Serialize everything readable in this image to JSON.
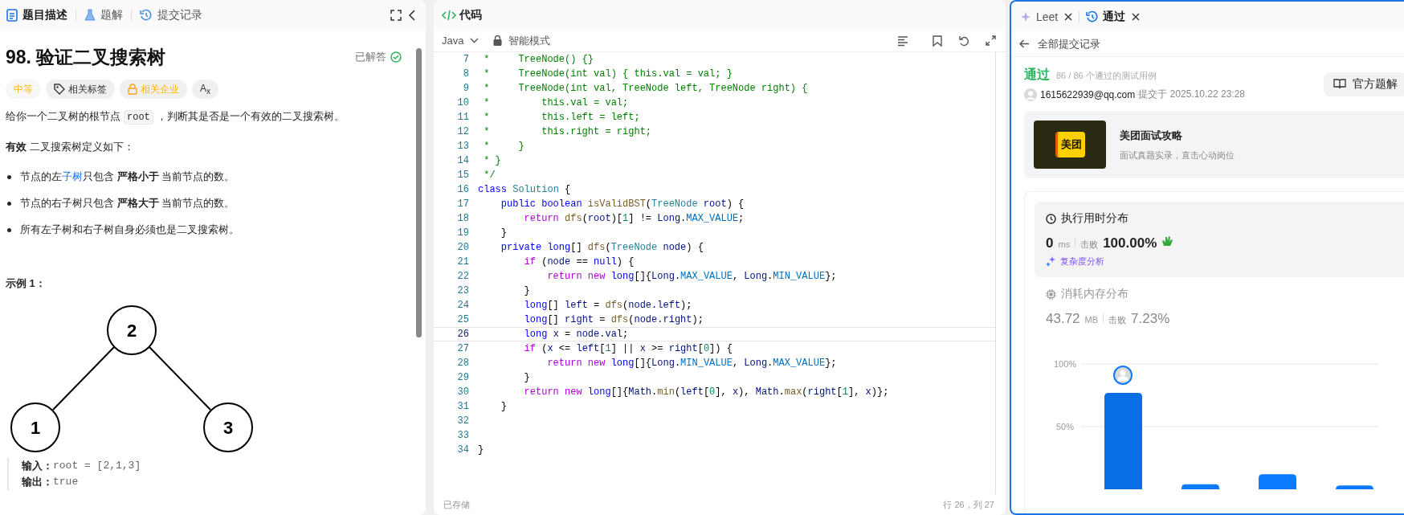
{
  "description_panel": {
    "tabs": [
      {
        "label": "题目描述",
        "kind": "description",
        "selected": true
      },
      {
        "label": "题解",
        "kind": "solutions",
        "selected": false
      },
      {
        "label": "提交记录",
        "kind": "submissions",
        "selected": false
      }
    ],
    "title": "98. 验证二叉搜索树",
    "status": "已解答",
    "tags": [
      {
        "label": "中等",
        "kind": "difficulty"
      },
      {
        "label": "相关标签",
        "kind": "topics"
      },
      {
        "label": "相关企业",
        "kind": "companies"
      },
      {
        "label": "A$_{x}$",
        "kind": "translate"
      }
    ],
    "intro": {
      "before": "给你一个二叉树的根节点",
      "code": "root",
      "after": "，判断其是否是一个有效的二叉搜索树。"
    },
    "definition": "**有效** 二叉搜索树定义如下：",
    "bullets": [
      {
        "text": "节点的左",
        "link": "子树",
        "after": "只包含 **严格小于** 当前节点的数。"
      },
      {
        "text": "节点的右子树只包含 **严格大于** 当前节点的数。"
      },
      {
        "text": "所有左子树和右子树自身必须也是二叉搜索树。"
      }
    ],
    "example_title": "示例 1：",
    "example_tree": {
      "value": "2",
      "children": [
        {
          "value": "1"
        },
        {
          "value": "3"
        }
      ]
    },
    "example_io": [
      {
        "label": "输入：",
        "value": "root = [2,1,3]"
      },
      {
        "label": "输出：",
        "value": "true"
      }
    ]
  },
  "code_panel": {
    "title": "代码",
    "language": "Java",
    "mode": "智能模式",
    "lines": [
      {
        "number": "7",
        "current": false,
        "tokens": [
          {
            "kind": "comment",
            "text": " *     TreeNode() {}"
          }
        ]
      },
      {
        "number": "8",
        "current": false,
        "tokens": [
          {
            "kind": "comment",
            "text": " *     TreeNode(int val) { this.val = val; }"
          }
        ]
      },
      {
        "number": "9",
        "current": false,
        "tokens": [
          {
            "kind": "comment",
            "text": " *     TreeNode(int val, TreeNode left, TreeNode right) {"
          }
        ]
      },
      {
        "number": "10",
        "current": false,
        "tokens": [
          {
            "kind": "comment",
            "text": " *         this.val = val;"
          }
        ]
      },
      {
        "number": "11",
        "current": false,
        "tokens": [
          {
            "kind": "comment",
            "text": " *         this.left = left;"
          }
        ]
      },
      {
        "number": "12",
        "current": false,
        "tokens": [
          {
            "kind": "comment",
            "text": " *         this.right = right;"
          }
        ]
      },
      {
        "number": "13",
        "current": false,
        "tokens": [
          {
            "kind": "comment",
            "text": " *     }"
          }
        ]
      },
      {
        "number": "14",
        "current": false,
        "tokens": [
          {
            "kind": "comment",
            "text": " * }"
          }
        ]
      },
      {
        "number": "15",
        "current": false,
        "tokens": [
          {
            "kind": "comment",
            "text": " */"
          }
        ]
      },
      {
        "number": "16",
        "current": false,
        "tokens": [
          {
            "kind": "keyword",
            "text": "class "
          },
          {
            "kind": "type",
            "text": "Solution"
          },
          {
            "kind": "plain",
            "text": " {"
          }
        ]
      },
      {
        "number": "17",
        "current": false,
        "tokens": [
          {
            "kind": "keyword",
            "text": "    public boolean "
          },
          {
            "kind": "function",
            "text": "isValidBST"
          },
          {
            "kind": "plain",
            "text": "("
          },
          {
            "kind": "type",
            "text": "TreeNode "
          },
          {
            "kind": "variable",
            "text": "root"
          },
          {
            "kind": "plain",
            "text": ") {"
          }
        ]
      },
      {
        "number": "18",
        "current": false,
        "tokens": [
          {
            "kind": "control",
            "text": "        return "
          },
          {
            "kind": "function",
            "text": "dfs"
          },
          {
            "kind": "plain",
            "text": "("
          },
          {
            "kind": "variable",
            "text": "root"
          },
          {
            "kind": "plain",
            "text": ")["
          },
          {
            "kind": "number",
            "text": "1"
          },
          {
            "kind": "plain",
            "text": "] != "
          },
          {
            "kind": "variable",
            "text": "Long"
          },
          {
            "kind": "plain",
            "text": "."
          },
          {
            "kind": "constant",
            "text": "MAX_VALUE"
          },
          {
            "kind": "plain",
            "text": ";"
          }
        ]
      },
      {
        "number": "19",
        "current": false,
        "tokens": [
          {
            "kind": "plain",
            "text": "    }"
          }
        ]
      },
      {
        "number": "20",
        "current": false,
        "tokens": [
          {
            "kind": "keyword",
            "text": "    private long"
          },
          {
            "kind": "plain",
            "text": "[] "
          },
          {
            "kind": "function",
            "text": "dfs"
          },
          {
            "kind": "plain",
            "text": "("
          },
          {
            "kind": "type",
            "text": "TreeNode "
          },
          {
            "kind": "variable",
            "text": "node"
          },
          {
            "kind": "plain",
            "text": ") {"
          }
        ]
      },
      {
        "number": "21",
        "current": false,
        "tokens": [
          {
            "kind": "control",
            "text": "        if "
          },
          {
            "kind": "plain",
            "text": "("
          },
          {
            "kind": "variable",
            "text": "node"
          },
          {
            "kind": "plain",
            "text": " == "
          },
          {
            "kind": "keyword",
            "text": "null"
          },
          {
            "kind": "plain",
            "text": ") {"
          }
        ]
      },
      {
        "number": "22",
        "current": false,
        "tokens": [
          {
            "kind": "control",
            "text": "            return new "
          },
          {
            "kind": "keyword",
            "text": "long"
          },
          {
            "kind": "plain",
            "text": "[]{"
          },
          {
            "kind": "variable",
            "text": "Long"
          },
          {
            "kind": "plain",
            "text": "."
          },
          {
            "kind": "constant",
            "text": "MAX_VALUE"
          },
          {
            "kind": "plain",
            "text": ", "
          },
          {
            "kind": "variable",
            "text": "Long"
          },
          {
            "kind": "plain",
            "text": "."
          },
          {
            "kind": "constant",
            "text": "MIN_VALUE"
          },
          {
            "kind": "plain",
            "text": "};"
          }
        ]
      },
      {
        "number": "23",
        "current": false,
        "tokens": [
          {
            "kind": "plain",
            "text": "        }"
          }
        ]
      },
      {
        "number": "24",
        "current": false,
        "tokens": [
          {
            "kind": "keyword",
            "text": "        long"
          },
          {
            "kind": "plain",
            "text": "[] "
          },
          {
            "kind": "variable",
            "text": "left"
          },
          {
            "kind": "plain",
            "text": " = "
          },
          {
            "kind": "function",
            "text": "dfs"
          },
          {
            "kind": "plain",
            "text": "("
          },
          {
            "kind": "variable",
            "text": "node.left"
          },
          {
            "kind": "plain",
            "text": ");"
          }
        ]
      },
      {
        "number": "25",
        "current": false,
        "tokens": [
          {
            "kind": "keyword",
            "text": "        long"
          },
          {
            "kind": "plain",
            "text": "[] "
          },
          {
            "kind": "variable",
            "text": "right"
          },
          {
            "kind": "plain",
            "text": " = "
          },
          {
            "kind": "function",
            "text": "dfs"
          },
          {
            "kind": "plain",
            "text": "("
          },
          {
            "kind": "variable",
            "text": "node.right"
          },
          {
            "kind": "plain",
            "text": ");"
          }
        ]
      },
      {
        "number": "26",
        "current": true,
        "tokens": [
          {
            "kind": "keyword",
            "text": "        long "
          },
          {
            "kind": "variable",
            "text": "x"
          },
          {
            "kind": "plain",
            "text": " = "
          },
          {
            "kind": "variable",
            "text": "node.val"
          },
          {
            "kind": "plain",
            "text": ";"
          }
        ]
      },
      {
        "number": "27",
        "current": false,
        "tokens": [
          {
            "kind": "control",
            "text": "        if "
          },
          {
            "kind": "plain",
            "text": "("
          },
          {
            "kind": "variable",
            "text": "x"
          },
          {
            "kind": "plain",
            "text": " <= "
          },
          {
            "kind": "variable",
            "text": "left"
          },
          {
            "kind": "plain",
            "text": "["
          },
          {
            "kind": "number",
            "text": "1"
          },
          {
            "kind": "plain",
            "text": "] || "
          },
          {
            "kind": "variable",
            "text": "x"
          },
          {
            "kind": "plain",
            "text": " >= "
          },
          {
            "kind": "variable",
            "text": "right"
          },
          {
            "kind": "plain",
            "text": "["
          },
          {
            "kind": "number",
            "text": "0"
          },
          {
            "kind": "plain",
            "text": "]) {"
          }
        ]
      },
      {
        "number": "28",
        "current": false,
        "tokens": [
          {
            "kind": "control",
            "text": "            return new "
          },
          {
            "kind": "keyword",
            "text": "long"
          },
          {
            "kind": "plain",
            "text": "[]{"
          },
          {
            "kind": "variable",
            "text": "Long"
          },
          {
            "kind": "plain",
            "text": "."
          },
          {
            "kind": "constant",
            "text": "MIN_VALUE"
          },
          {
            "kind": "plain",
            "text": ", "
          },
          {
            "kind": "variable",
            "text": "Long"
          },
          {
            "kind": "plain",
            "text": "."
          },
          {
            "kind": "constant",
            "text": "MAX_VALUE"
          },
          {
            "kind": "plain",
            "text": "};"
          }
        ]
      },
      {
        "number": "29",
        "current": false,
        "tokens": [
          {
            "kind": "plain",
            "text": "        }"
          }
        ]
      },
      {
        "number": "30",
        "current": false,
        "tokens": [
          {
            "kind": "control",
            "text": "        return new "
          },
          {
            "kind": "keyword",
            "text": "long"
          },
          {
            "kind": "plain",
            "text": "[]{"
          },
          {
            "kind": "variable",
            "text": "Math"
          },
          {
            "kind": "plain",
            "text": "."
          },
          {
            "kind": "function",
            "text": "min"
          },
          {
            "kind": "plain",
            "text": "("
          },
          {
            "kind": "variable",
            "text": "left"
          },
          {
            "kind": "plain",
            "text": "["
          },
          {
            "kind": "number",
            "text": "0"
          },
          {
            "kind": "plain",
            "text": "], "
          },
          {
            "kind": "variable",
            "text": "x"
          },
          {
            "kind": "plain",
            "text": "), "
          },
          {
            "kind": "variable",
            "text": "Math"
          },
          {
            "kind": "plain",
            "text": "."
          },
          {
            "kind": "function",
            "text": "max"
          },
          {
            "kind": "plain",
            "text": "("
          },
          {
            "kind": "variable",
            "text": "right"
          },
          {
            "kind": "plain",
            "text": "["
          },
          {
            "kind": "number",
            "text": "1"
          },
          {
            "kind": "plain",
            "text": "], "
          },
          {
            "kind": "variable",
            "text": "x"
          },
          {
            "kind": "plain",
            "text": ")};"
          }
        ]
      },
      {
        "number": "31",
        "current": false,
        "tokens": [
          {
            "kind": "plain",
            "text": "    }"
          }
        ]
      },
      {
        "number": "32",
        "current": false
      },
      {
        "number": "33",
        "current": false
      },
      {
        "number": "34",
        "current": false,
        "tokens": [
          {
            "kind": "plain",
            "text": "}"
          }
        ]
      }
    ],
    "save_status": "已存储",
    "cursor": "行 26，列 27"
  },
  "result_panel": {
    "tabs": [
      {
        "label": "Leet",
        "kind": "assistant",
        "selected": false
      },
      {
        "label": "通过",
        "kind": "submission",
        "selected": true
      }
    ],
    "back_link": "全部提交记录",
    "verdict": "通过",
    "testcases": "86 / 86 个通过的测试用例",
    "user": "1615622939@qq.com",
    "submitted": "提交于 2025.10.22 23:28",
    "solution_button": "官方题解",
    "promo": {
      "logo": "美团",
      "title": "美团面试攻略",
      "subtitle": "面试真题实录，直击心动岗位"
    },
    "metrics": [
      {
        "kind": "runtime",
        "selected": true,
        "title": "执行用时分布",
        "value": "0",
        "unit": "ms",
        "beats_label": "击败",
        "beats": "100.00%",
        "link": "复杂度分析"
      },
      {
        "kind": "memory",
        "selected": false,
        "title": "消耗内存分布",
        "value": "43.72",
        "unit": "MB",
        "beats_label": "击败",
        "beats": "7.23%",
        "chart_data": {
          "type": "bar",
          "values": [
            77,
            4,
            12,
            3
          ],
          "ylim": [
            0,
            100
          ],
          "yticks": [
            {
              "value": 50,
              "label": "50%"
            },
            {
              "value": 100,
              "label": "100%"
            }
          ]
        }
      }
    ]
  }
}
